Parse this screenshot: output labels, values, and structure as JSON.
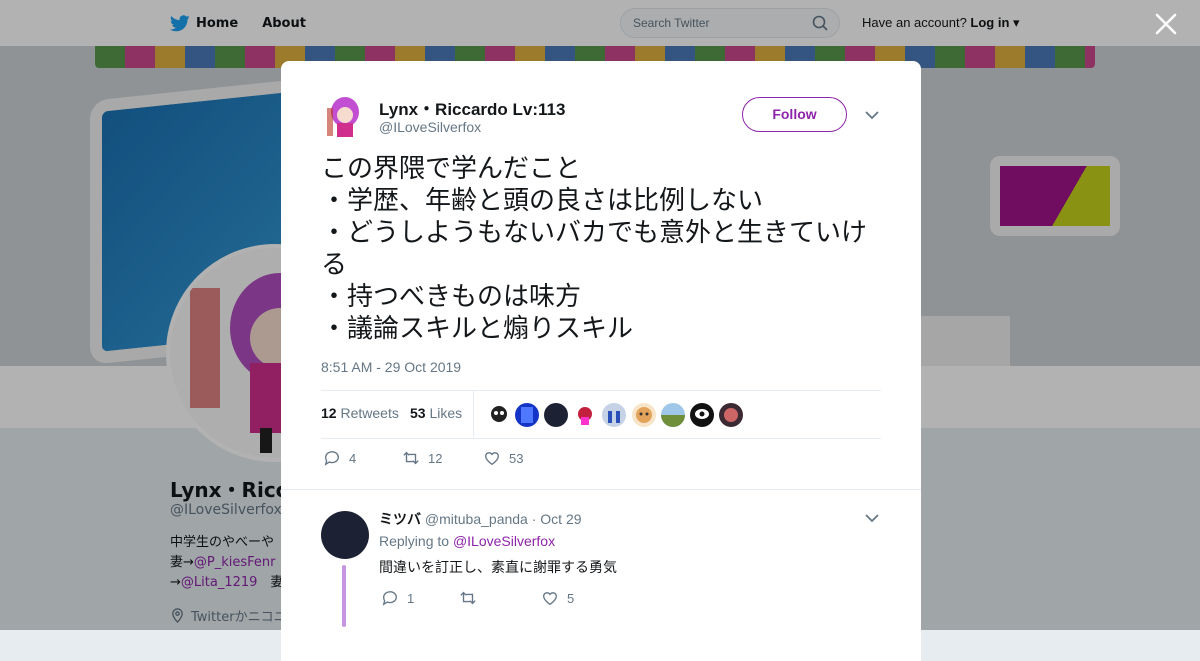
{
  "nav": {
    "home_label": "Home",
    "about_label": "About",
    "search_placeholder": "Search Twitter",
    "have_account": "Have an account?",
    "login_label": "Log in"
  },
  "profile": {
    "name": "Lynx・Ricc",
    "handle": "@ILoveSilverfox",
    "bio_line1": "中学生のやべーや",
    "bio_line2_prefix": "妻→",
    "bio_line2_link": "@P_kiesFenr",
    "bio_line3_prefix": "→",
    "bio_line3_link": "@Lita_1219",
    "bio_line3_suffix": "　妻",
    "location": "Twitterかニコニ"
  },
  "tweet": {
    "name": "Lynx・Riccardo Lv:113",
    "handle": "@ILoveSilverfox",
    "follow_label": "Follow",
    "text": "この界隈で学んだこと\n・学歴、年齢と頭の良さは比例しない\n・どうしようもないバカでも意外と生きていける\n・持つべきものは味方\n・議論スキルと煽りスキル",
    "timestamp": "8:51 AM - 29 Oct 2019",
    "retweets_count": "12",
    "retweets_label": "Retweets",
    "likes_count": "53",
    "likes_label": "Likes",
    "actions": {
      "replies": "4",
      "retweets": "12",
      "likes": "53"
    }
  },
  "reply": {
    "name": "ミツバ",
    "handle": "@mituba_panda",
    "date": "· Oct 29",
    "replying_prefix": "Replying to",
    "replying_to": "@ILoveSilverfox",
    "text": "間違いを訂正し、素直に謝罪する勇気",
    "actions": {
      "replies": "1",
      "retweets": "",
      "likes": "5"
    }
  },
  "colors": {
    "accent": "#8e24aa",
    "twitter_blue": "#1da1f2",
    "text": "#14171a",
    "muted": "#657786"
  }
}
